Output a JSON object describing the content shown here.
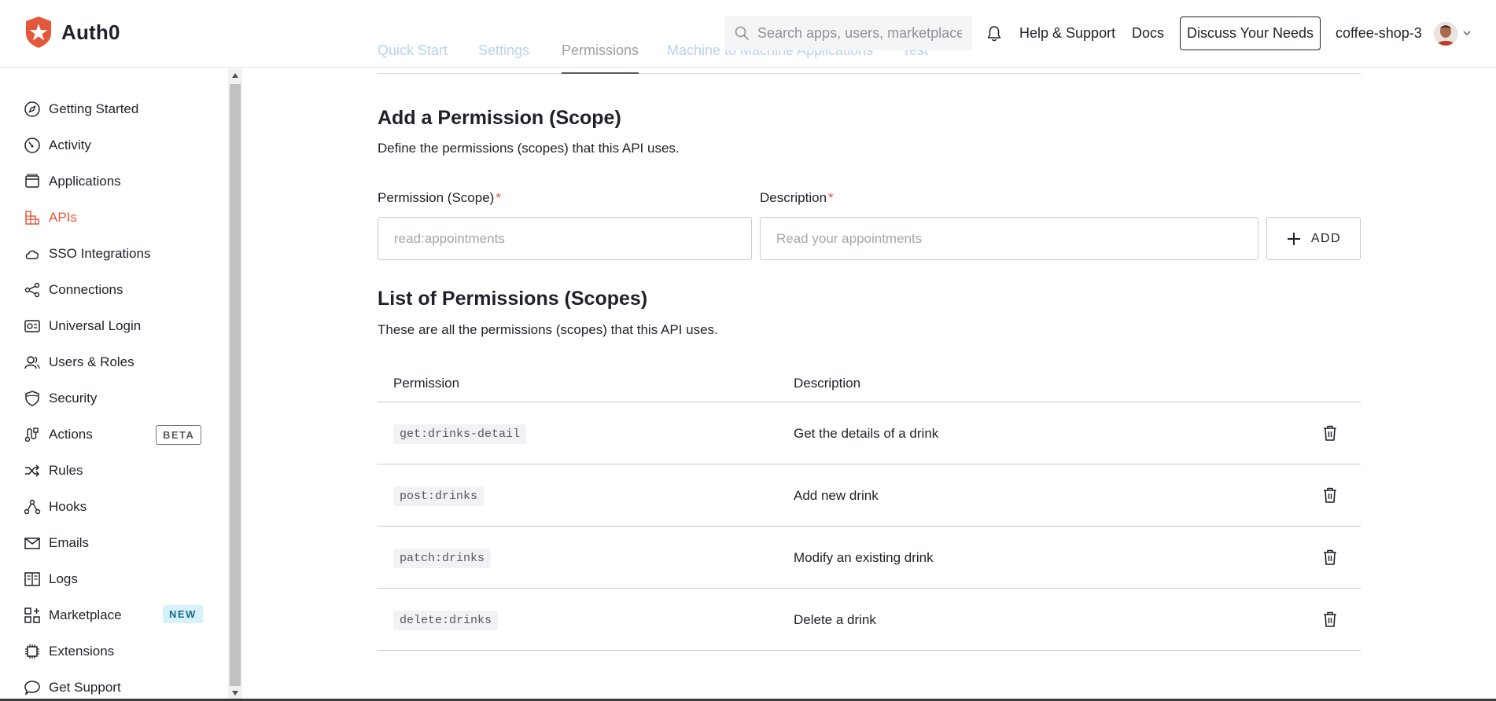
{
  "header": {
    "brand": "Auth0",
    "search_placeholder": "Search apps, users, marketplace",
    "help_label": "Help & Support",
    "docs_label": "Docs",
    "discuss_label": "Discuss Your Needs",
    "tenant_name": "coffee-shop-3"
  },
  "tabs": [
    {
      "label": "Quick Start"
    },
    {
      "label": "Settings"
    },
    {
      "label": "Permissions"
    },
    {
      "label": "Machine to Machine Applications"
    },
    {
      "label": "Test"
    }
  ],
  "sidebar": {
    "items": [
      {
        "label": "Getting Started",
        "icon": "compass-icon"
      },
      {
        "label": "Activity",
        "icon": "gauge-icon"
      },
      {
        "label": "Applications",
        "icon": "window-icon"
      },
      {
        "label": "APIs",
        "icon": "apis-icon",
        "active": true
      },
      {
        "label": "SSO Integrations",
        "icon": "cloud-icon"
      },
      {
        "label": "Connections",
        "icon": "connections-icon"
      },
      {
        "label": "Universal Login",
        "icon": "universal-login-icon"
      },
      {
        "label": "Users & Roles",
        "icon": "users-icon"
      },
      {
        "label": "Security",
        "icon": "shield-icon"
      },
      {
        "label": "Actions",
        "icon": "actions-icon",
        "badge": "BETA"
      },
      {
        "label": "Rules",
        "icon": "shuffle-icon"
      },
      {
        "label": "Hooks",
        "icon": "hooks-icon"
      },
      {
        "label": "Emails",
        "icon": "mail-icon"
      },
      {
        "label": "Logs",
        "icon": "book-icon"
      },
      {
        "label": "Marketplace",
        "icon": "grid-plus-icon",
        "badge": "NEW"
      },
      {
        "label": "Extensions",
        "icon": "chip-icon"
      },
      {
        "label": "Get Support",
        "icon": "chat-icon"
      }
    ]
  },
  "add_section": {
    "title": "Add a Permission (Scope)",
    "description": "Define the permissions (scopes) that this API uses.",
    "scope_label": "Permission (Scope)",
    "scope_placeholder": "read:appointments",
    "desc_label": "Description",
    "desc_placeholder": "Read your appointments",
    "required_mark": "*",
    "add_label": "ADD"
  },
  "list_section": {
    "title": "List of Permissions (Scopes)",
    "description": "These are all the permissions (scopes) that this API uses.",
    "columns": [
      "Permission",
      "Description"
    ],
    "rows": [
      {
        "permission": "get:drinks-detail",
        "description": "Get the details of a drink"
      },
      {
        "permission": "post:drinks",
        "description": "Add new drink"
      },
      {
        "permission": "patch:drinks",
        "description": "Modify an existing drink"
      },
      {
        "permission": "delete:drinks",
        "description": "Delete a drink"
      }
    ]
  },
  "colors": {
    "accent": "#e3573a",
    "text": "#1e212a",
    "tab_faded": "#b7d3ee",
    "new_badge_bg": "#d6f1fa"
  }
}
